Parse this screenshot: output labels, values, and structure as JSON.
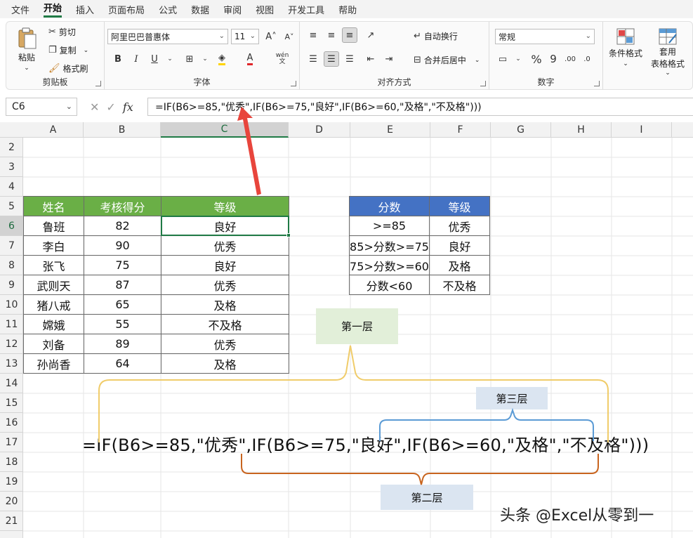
{
  "menu": [
    "文件",
    "开始",
    "插入",
    "页面布局",
    "公式",
    "数据",
    "审阅",
    "视图",
    "开发工具",
    "帮助"
  ],
  "menu_active": "开始",
  "ribbon": {
    "clipboard": {
      "paste": "粘贴",
      "cut": "剪切",
      "copy": "复制",
      "format_painter": "格式刷",
      "label": "剪贴板"
    },
    "font": {
      "font_name": "阿里巴巴普惠体",
      "font_size": "11",
      "bold": "B",
      "italic": "I",
      "underline": "U",
      "pinyin": "wén",
      "label": "字体"
    },
    "alignment": {
      "wrap": "自动换行",
      "merge": "合并后居中",
      "label": "对齐方式"
    },
    "number": {
      "format": "常规",
      "percent": "%",
      "comma": "9",
      "label": "数字"
    },
    "styles": {
      "conditional": "条件格式",
      "table_format_line1": "套用",
      "table_format_line2": "表格格式"
    }
  },
  "formula_bar": {
    "name_box": "C6",
    "formula": "=IF(B6>=85,\"优秀\",IF(B6>=75,\"良好\",IF(B6>=60,\"及格\",\"不及格\")))"
  },
  "columns": [
    "A",
    "B",
    "C",
    "D",
    "E",
    "F",
    "G",
    "H",
    "I"
  ],
  "rows": [
    "2",
    "3",
    "4",
    "5",
    "6",
    "7",
    "8",
    "9",
    "10",
    "11",
    "12",
    "13",
    "14",
    "15",
    "16",
    "17",
    "18",
    "19",
    "20",
    "21"
  ],
  "main_table": {
    "headers": [
      "姓名",
      "考核得分",
      "等级"
    ],
    "rows": [
      [
        "鲁班",
        "82",
        "良好"
      ],
      [
        "李白",
        "90",
        "优秀"
      ],
      [
        "张飞",
        "75",
        "良好"
      ],
      [
        "武则天",
        "87",
        "优秀"
      ],
      [
        "猪八戒",
        "65",
        "及格"
      ],
      [
        "嫦娥",
        "55",
        "不及格"
      ],
      [
        "刘备",
        "89",
        "优秀"
      ],
      [
        "孙尚香",
        "64",
        "及格"
      ]
    ]
  },
  "grade_table": {
    "headers": [
      "分数",
      "等级"
    ],
    "rows": [
      [
        ">=85",
        "优秀"
      ],
      [
        "85>分数>=75",
        "良好"
      ],
      [
        "75>分数>=60",
        "及格"
      ],
      [
        "分数<60",
        "不及格"
      ]
    ]
  },
  "annotations": {
    "layer1": "第一层",
    "layer2": "第二层",
    "layer3": "第三层",
    "big_formula": "=IF(B6>=85,\"优秀\",IF(B6>=75,\"良好\",IF(B6>=60,\"及格\",\"不及格\")))",
    "watermark": "头条 @Excel从零到一"
  },
  "colors": {
    "accent": "#1f7a45",
    "main_header": "#6aaf46",
    "grade_header": "#4472c4",
    "layer1_fill": "#e2efd9",
    "layer_fill": "#dbe5f1",
    "brace_outer": "#f0cc6a",
    "brace_middle": "#c8641e",
    "brace_inner": "#5b9bd5",
    "arrow": "#e8453c"
  }
}
